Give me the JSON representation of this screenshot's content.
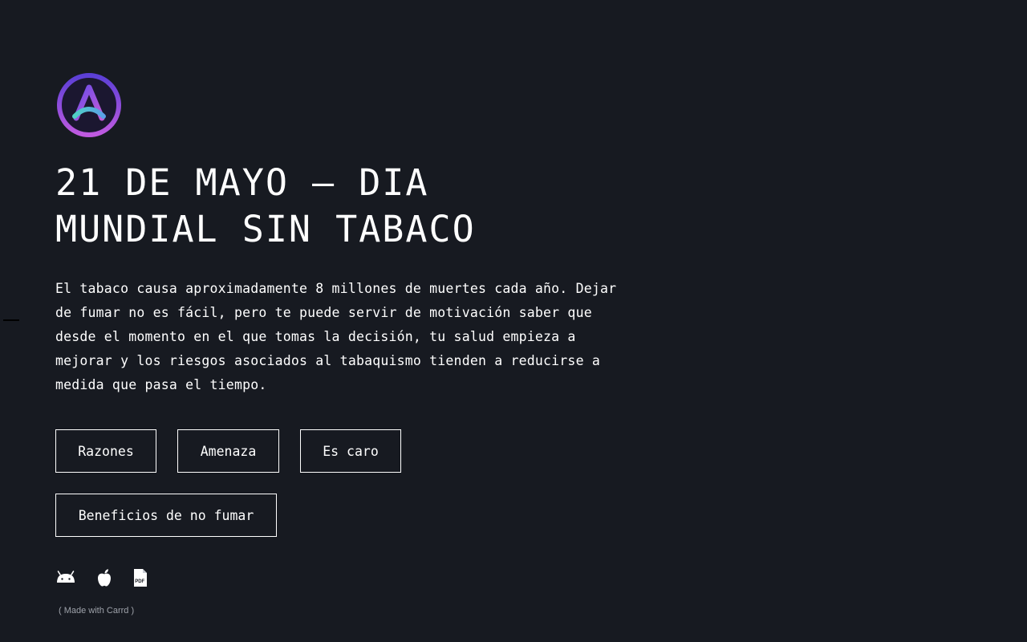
{
  "hero": {
    "title_line1": "21 DE MAYO – DIA",
    "title_line2": "MUNDIAL SIN TABACO",
    "intro": "El tabaco causa aproximadamente 8 millones de muertes cada año. Dejar\nde fumar no es fácil, pero te puede servir de motivación saber que\ndesde el momento en el que tomas la decisión, tu salud empieza a\nmejorar y los riesgos asociados al tabaquismo tienden a reducirse a\nmedida que pasa el tiempo."
  },
  "buttons": {
    "razones": "Razones",
    "amenaza": "Amenaza",
    "caro": "Es caro",
    "beneficios": "Beneficios de no fumar"
  },
  "icons": [
    "android-icon",
    "apple-icon",
    "pdf-icon"
  ],
  "footer": {
    "credit": "( Made with Carrd )"
  },
  "colors": {
    "background": "#171a21",
    "text": "#ffffff",
    "logo_ring_start": "#5b3fd6",
    "logo_ring_end": "#c05ae0",
    "logo_accent": "#4fc3d9"
  }
}
